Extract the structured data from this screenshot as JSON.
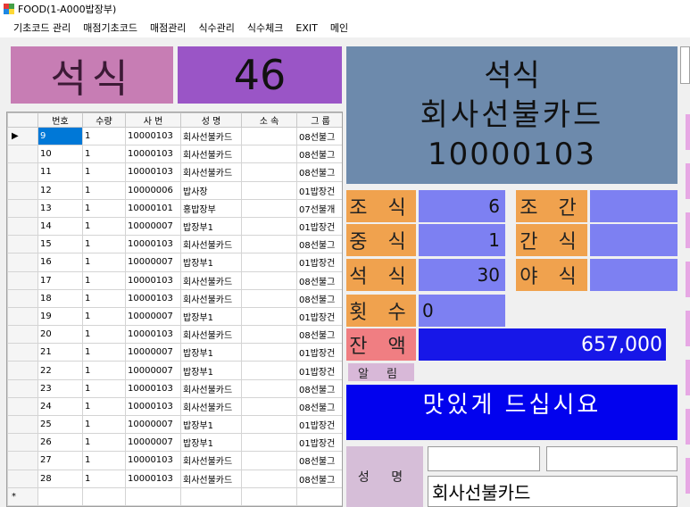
{
  "window": {
    "title": "FOOD(1-A000밥장부)"
  },
  "menu": [
    "기초코드 관리",
    "매점기초코드",
    "매점관리",
    "식수관리",
    "식수체크",
    "EXIT",
    "메인"
  ],
  "meal_type_display": "석식",
  "count_display": "46",
  "grid": {
    "columns": [
      "번호",
      "수량",
      "사  번",
      "성  명",
      "소  속",
      "그  룹"
    ],
    "rows": [
      [
        "9",
        "1",
        "10000103",
        "회사선불카드",
        "",
        "08선불그"
      ],
      [
        "10",
        "1",
        "10000103",
        "회사선불카드",
        "",
        "08선불그"
      ],
      [
        "11",
        "1",
        "10000103",
        "회사선불카드",
        "",
        "08선불그"
      ],
      [
        "12",
        "1",
        "10000006",
        "밥사장",
        "",
        "01밥장건"
      ],
      [
        "13",
        "1",
        "10000101",
        "홍밥장부",
        "",
        "07선불개"
      ],
      [
        "14",
        "1",
        "10000007",
        "밥장부1",
        "",
        "01밥장건"
      ],
      [
        "15",
        "1",
        "10000103",
        "회사선불카드",
        "",
        "08선불그"
      ],
      [
        "16",
        "1",
        "10000007",
        "밥장부1",
        "",
        "01밥장건"
      ],
      [
        "17",
        "1",
        "10000103",
        "회사선불카드",
        "",
        "08선불그"
      ],
      [
        "18",
        "1",
        "10000103",
        "회사선불카드",
        "",
        "08선불그"
      ],
      [
        "19",
        "1",
        "10000007",
        "밥장부1",
        "",
        "01밥장건"
      ],
      [
        "20",
        "1",
        "10000103",
        "회사선불카드",
        "",
        "08선불그"
      ],
      [
        "21",
        "1",
        "10000007",
        "밥장부1",
        "",
        "01밥장건"
      ],
      [
        "22",
        "1",
        "10000007",
        "밥장부1",
        "",
        "01밥장건"
      ],
      [
        "23",
        "1",
        "10000103",
        "회사선불카드",
        "",
        "08선불그"
      ],
      [
        "24",
        "1",
        "10000103",
        "회사선불카드",
        "",
        "08선불그"
      ],
      [
        "25",
        "1",
        "10000007",
        "밥장부1",
        "",
        "01밥장건"
      ],
      [
        "26",
        "1",
        "10000007",
        "밥장부1",
        "",
        "01밥장건"
      ],
      [
        "27",
        "1",
        "10000103",
        "회사선불카드",
        "",
        "08선불그"
      ],
      [
        "28",
        "1",
        "10000103",
        "회사선불카드",
        "",
        "08선불그"
      ]
    ],
    "current_row_marker": "▶",
    "new_row_marker": "*"
  },
  "info": {
    "line1": "석식",
    "line2": "회사선불카드",
    "line3": "10000103"
  },
  "meals": {
    "breakfast_label": "조 식",
    "breakfast_value": "6",
    "lunch_label": "중 식",
    "lunch_value": "1",
    "dinner_label": "석 식",
    "dinner_value": "30",
    "count_label": "횟 수",
    "count_value": "0",
    "early_label": "조 간",
    "early_value": "",
    "snack_label": "간 식",
    "snack_value": "",
    "night_label": "야 식",
    "night_value": ""
  },
  "balance": {
    "label": "잔 액",
    "value": "657,000"
  },
  "notice": {
    "label": "알 림",
    "message": "맛있게 드십시요"
  },
  "name": {
    "label": "성 명",
    "value": "회사선불카드"
  },
  "colors": {
    "meal_box": "#c77db4",
    "count_box": "#9a55c6",
    "info_panel": "#6d8aac",
    "label_orange": "#f0a24e",
    "value_blue": "#7d80f2",
    "balance_blue": "#1717e8",
    "notice_blue": "#0202ee",
    "selected_row": "#0078d7"
  }
}
